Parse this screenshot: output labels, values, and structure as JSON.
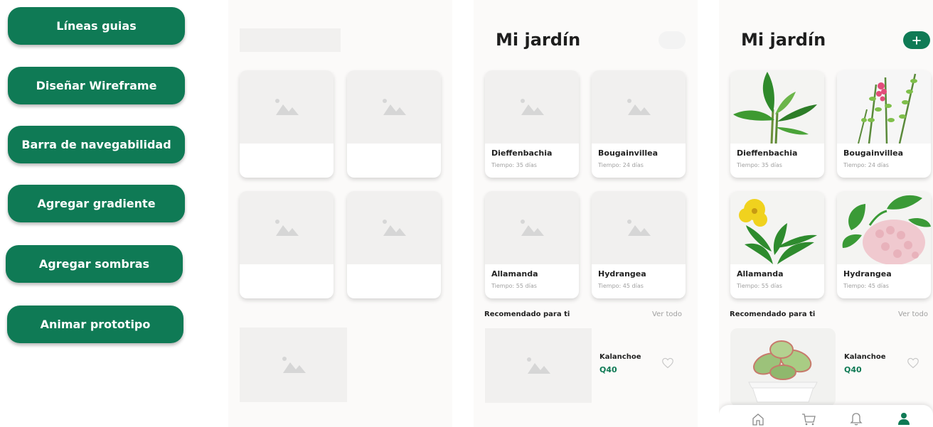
{
  "steps": [
    {
      "label": "Líneas guias"
    },
    {
      "label": "Diseñar Wireframe"
    },
    {
      "label": "Barra de navegabilidad"
    },
    {
      "label": "Agregar gradiente"
    },
    {
      "label": "Agregar sombras"
    },
    {
      "label": "Animar prototipo"
    }
  ],
  "screen2": {
    "title": "Mi jardín",
    "plants": [
      {
        "name": "Dieffenbachia",
        "time": "Tiempo: 35 días"
      },
      {
        "name": "Bougainvillea",
        "time": "Tiempo: 24 días"
      },
      {
        "name": "Allamanda",
        "time": "Tiempo: 55 días"
      },
      {
        "name": "Hydrangea",
        "time": "Tiempo: 45 días"
      }
    ],
    "section": "Recomendado para ti",
    "see_all": "Ver todo",
    "rec": {
      "name": "Kalanchoe",
      "price": "Q40"
    }
  },
  "screen3": {
    "title": "Mi jardín",
    "add_icon": "plus-icon",
    "plants": [
      {
        "name": "Dieffenbachia",
        "time": "Tiempo: 35 días"
      },
      {
        "name": "Bougainvillea",
        "time": "Tiempo: 24 días"
      },
      {
        "name": "Allamanda",
        "time": "Tiempo: 55 días"
      },
      {
        "name": "Hydrangea",
        "time": "Tiempo: 45 días"
      }
    ],
    "section": "Recomendado para ti",
    "see_all": "Ver todo",
    "rec": {
      "name": "Kalanchoe",
      "price": "Q40"
    },
    "nav": [
      "home-icon",
      "cart-icon",
      "bell-icon",
      "user-icon"
    ]
  },
  "colors": {
    "primary": "#0f7a55",
    "placeholder": "#f1f0ef",
    "screen_bg": "#fbfaf9"
  }
}
